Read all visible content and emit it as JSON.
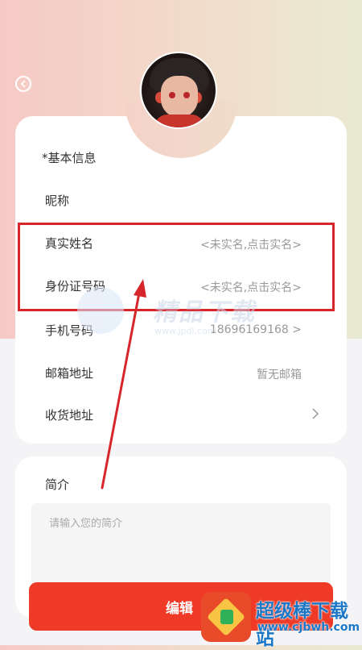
{
  "header": {
    "back_icon": "chevron-left-icon"
  },
  "profile": {
    "avatar_icon": "avatar-boy-illustration"
  },
  "basic_info": {
    "title": "*基本信息",
    "rows": [
      {
        "label": "昵称",
        "value": ""
      },
      {
        "label": "真实姓名",
        "value": "<未实名,点击实名>"
      },
      {
        "label": "身份证号码",
        "value": "<未实名,点击实名>"
      },
      {
        "label": "手机号码",
        "value": "18696169168 >"
      },
      {
        "label": "邮箱地址",
        "value": "暂无邮箱"
      },
      {
        "label": "收货地址",
        "value": ""
      }
    ]
  },
  "intro": {
    "title": "简介",
    "placeholder": "请输入您的简介"
  },
  "actions": {
    "edit_label": "编辑"
  },
  "watermarks": {
    "center_text": "精品下载",
    "center_url": "www.jpdl.com",
    "bottom_title": "超级棒下载站",
    "bottom_url": "www.cjbwh.com"
  },
  "colors": {
    "accent": "#ee3a26",
    "highlight": "#d7262b",
    "watermark_blue": "#1c78c7"
  }
}
